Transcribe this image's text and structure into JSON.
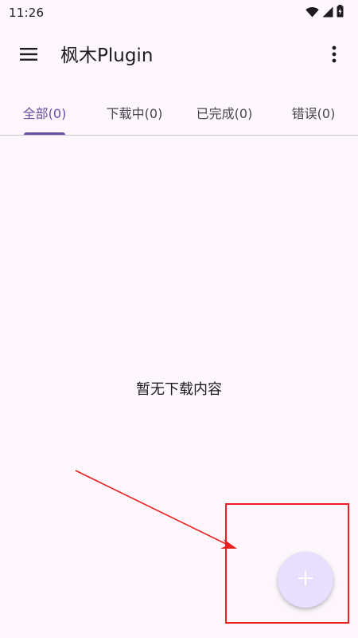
{
  "status_bar": {
    "time": "11:26",
    "icons": [
      "wifi-icon",
      "signal-icon",
      "battery-icon"
    ]
  },
  "app_bar": {
    "title": "枫木Plugin",
    "menu_icon": "menu-icon",
    "more_icon": "more-vert-icon"
  },
  "tabs": [
    {
      "label": "全部(0)",
      "active": true
    },
    {
      "label": "下载中(0)",
      "active": false
    },
    {
      "label": "已完成(0)",
      "active": false
    },
    {
      "label": "错误(0)",
      "active": false
    }
  ],
  "empty_state": {
    "message": "暂无下载内容"
  },
  "fab": {
    "icon": "plus-icon"
  },
  "colors": {
    "background": "#fdf7fd",
    "accent": "#6750a4",
    "fab_background": "#e8defd",
    "annotation_red": "#e8201f"
  }
}
